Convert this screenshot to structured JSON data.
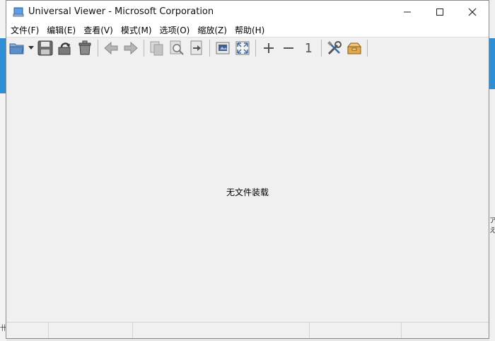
{
  "window": {
    "title": "Universal Viewer - Microsoft Corporation",
    "minimize_icon": "minimize-icon",
    "maximize_icon": "maximize-icon",
    "close_icon": "close-icon"
  },
  "menu": [
    {
      "label": "文件(F)"
    },
    {
      "label": "编辑(E)"
    },
    {
      "label": "查看(V)"
    },
    {
      "label": "模式(M)"
    },
    {
      "label": "选项(O)"
    },
    {
      "label": "缩放(Z)"
    },
    {
      "label": "帮助(H)"
    }
  ],
  "toolbar": {
    "buttons": [
      "open-folder-icon",
      "dropdown-arrow-icon",
      "save-icon",
      "reload-icon",
      "delete-icon",
      "back-icon",
      "forward-icon",
      "copy-icon",
      "find-icon",
      "export-icon",
      "fit-window-icon",
      "fullscreen-icon",
      "zoom-in-icon",
      "zoom-out-icon",
      "actual-size-icon",
      "settings-icon",
      "plugins-icon"
    ],
    "actual_size_label": "1"
  },
  "content": {
    "empty_message": "无文件装载"
  },
  "background": {
    "left_glyph": "卄",
    "right_glyph": "ア\nえ"
  }
}
